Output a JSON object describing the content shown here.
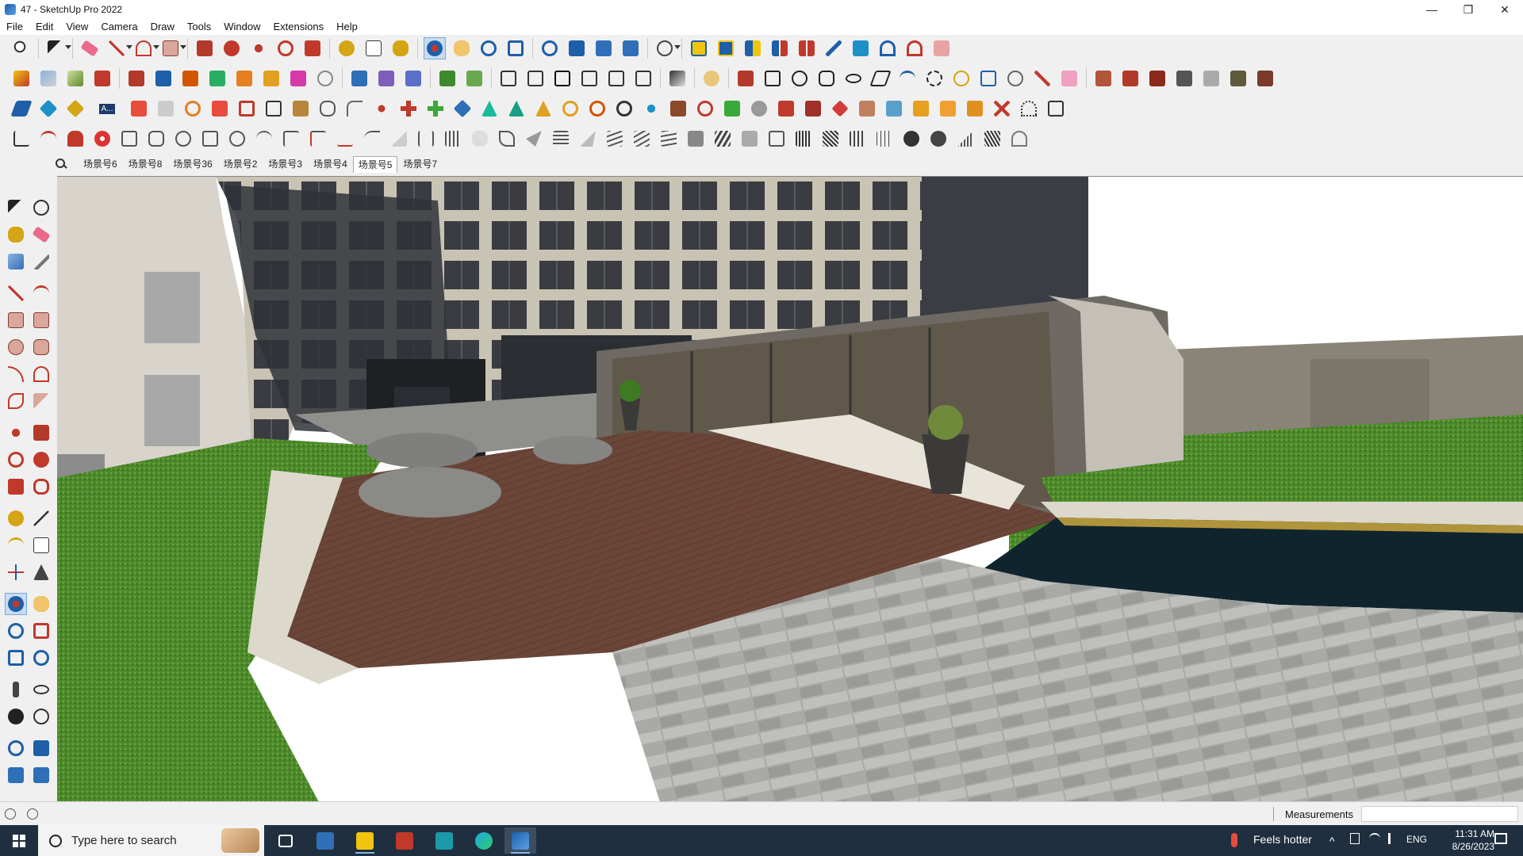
{
  "window": {
    "title": "47 - SketchUp Pro 2022",
    "controls": {
      "minimize": "—",
      "maximize": "❐",
      "close": "✕"
    }
  },
  "menubar": [
    "File",
    "Edit",
    "View",
    "Camera",
    "Draw",
    "Tools",
    "Window",
    "Extensions",
    "Help"
  ],
  "scenes": {
    "tabs": [
      "场景号6",
      "场景号8",
      "场景号36",
      "场景号2",
      "场景号3",
      "场景号4",
      "场景号5",
      "场景号7"
    ],
    "active": "场景号5"
  },
  "toolbar_row3_popup_label": "A...",
  "statusbar": {
    "measurements_label": "Measurements",
    "measurements_value": ""
  },
  "taskbar": {
    "search_placeholder": "Type here to search",
    "weather": "Feels hotter",
    "language": "ENG",
    "time": "11:31 AM",
    "date": "8/26/2023"
  },
  "colors": {
    "accent": "#1d5fa8",
    "taskbar": "#1f2f3f",
    "deck": "#6b4638",
    "grass": "#4e8a2c",
    "sky": "#ffffff"
  }
}
